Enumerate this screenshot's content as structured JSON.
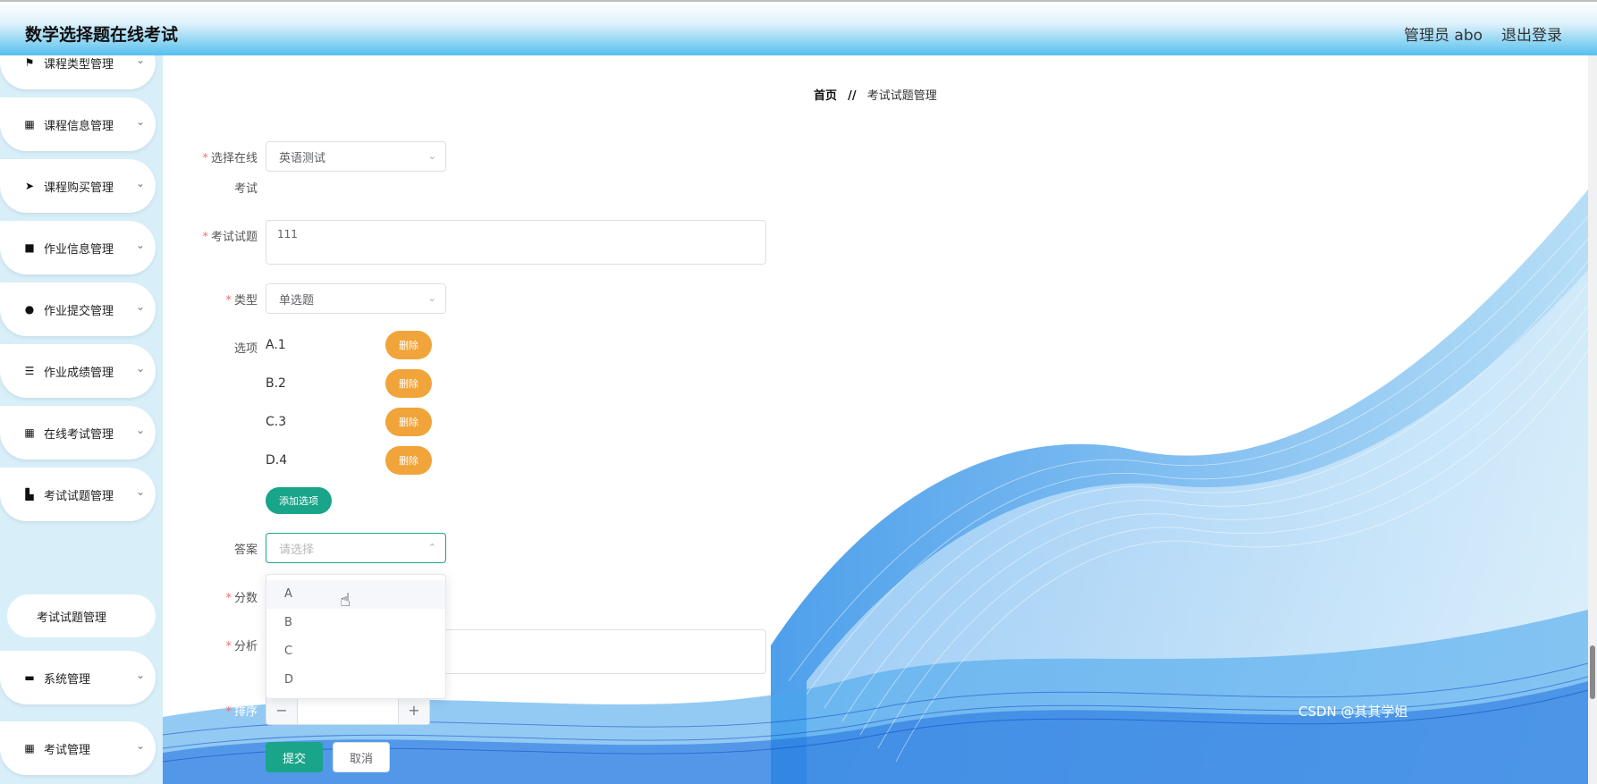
{
  "header": {
    "title": "数学选择题在线考试",
    "admin_label": "管理员 abo",
    "logout_label": "退出登录"
  },
  "sidebar": {
    "items": [
      {
        "label": "课程类型管理",
        "icon": "flag-icon"
      },
      {
        "label": "课程信息管理",
        "icon": "grid-icon"
      },
      {
        "label": "课程购买管理",
        "icon": "paper-plane-icon"
      },
      {
        "label": "作业信息管理",
        "icon": "briefcase-icon"
      },
      {
        "label": "作业提交管理",
        "icon": "user-icon"
      },
      {
        "label": "作业成绩管理",
        "icon": "list-icon"
      },
      {
        "label": "在线考试管理",
        "icon": "grid-icon"
      },
      {
        "label": "考试试题管理",
        "icon": "chart-icon"
      },
      {
        "label": "系统管理",
        "icon": "chat-icon"
      },
      {
        "label": "考试管理",
        "icon": "grid-icon"
      }
    ],
    "submenu_label": "考试试题管理"
  },
  "breadcrumb": {
    "home": "首页",
    "separator": "//",
    "current": "考试试题管理"
  },
  "form": {
    "exam": {
      "label_line1": "选择在线",
      "label_line2": "考试",
      "value": "英语测试"
    },
    "question": {
      "label": "考试试题",
      "value": "111"
    },
    "type": {
      "label": "类型",
      "value": "单选题"
    },
    "options": {
      "label": "选项",
      "items": [
        "A.1",
        "B.2",
        "C.3",
        "D.4"
      ],
      "delete_label": "删除",
      "add_label": "添加选项"
    },
    "answer": {
      "label": "答案",
      "placeholder": "请选择",
      "choices": [
        "A",
        "B",
        "C",
        "D"
      ]
    },
    "score": {
      "label": "分数"
    },
    "analysis": {
      "label": "分析"
    },
    "order": {
      "label": "排序",
      "minus": "−",
      "plus": "+"
    },
    "submit_label": "提交",
    "cancel_label": "取消"
  },
  "watermark": "CSDN @其其学姐",
  "colors": {
    "primary": "#19a58a",
    "warning": "#f0a43a",
    "required": "#f56c6c",
    "header_gradient_end": "#56c0ee"
  }
}
